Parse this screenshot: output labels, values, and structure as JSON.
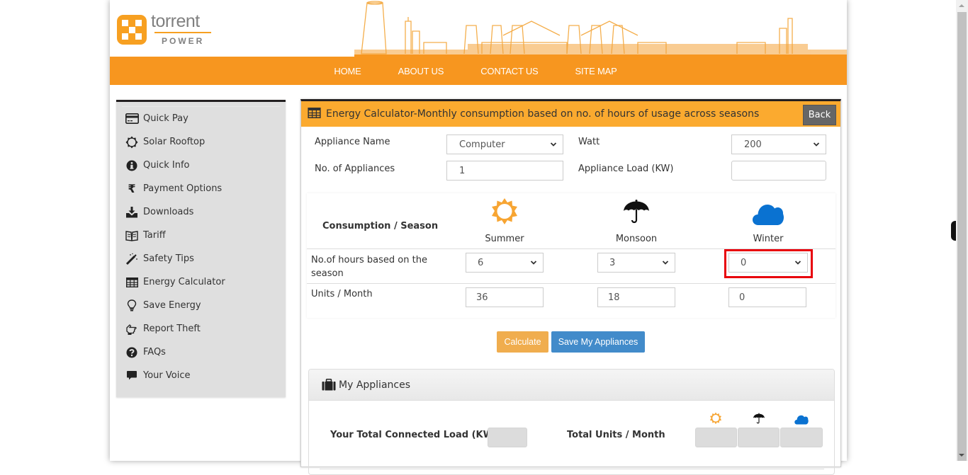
{
  "brand": {
    "name": "torrent",
    "sub": "POWER",
    "accent": "#f7961f"
  },
  "nav": {
    "items": [
      "HOME",
      "ABOUT US",
      "CONTACT US",
      "SITE MAP"
    ]
  },
  "sidebar": {
    "items": [
      {
        "label": "Quick Pay",
        "icon": "credit-card-icon"
      },
      {
        "label": "Solar Rooftop",
        "icon": "sun-outline-icon"
      },
      {
        "label": "Quick Info",
        "icon": "info-circle-icon"
      },
      {
        "label": "Payment Options",
        "icon": "rupee-icon"
      },
      {
        "label": "Downloads",
        "icon": "download-icon"
      },
      {
        "label": "Tariff",
        "icon": "book-icon"
      },
      {
        "label": "Safety Tips",
        "icon": "magic-wand-icon"
      },
      {
        "label": "Energy Calculator",
        "icon": "table-icon"
      },
      {
        "label": "Save Energy",
        "icon": "lightbulb-icon"
      },
      {
        "label": "Report Theft",
        "icon": "hand-pointer-icon"
      },
      {
        "label": "FAQs",
        "icon": "question-circle-icon"
      },
      {
        "label": "Your Voice",
        "icon": "comment-icon"
      }
    ]
  },
  "panel": {
    "title": "Energy Calculator-Monthly consumption based on no. of hours of usage across seasons",
    "back_label": "Back",
    "appliance_name_label": "Appliance Name",
    "appliance_name_value": "Computer",
    "watt_label": "Watt",
    "watt_value": "200",
    "num_appliances_label": "No. of Appliances",
    "num_appliances_value": "1",
    "appliance_load_label": "Appliance Load (KW)",
    "appliance_load_value": "",
    "consumption_header": "Consumption / Season",
    "seasons": [
      {
        "name": "Summer",
        "icon": "sun-icon",
        "hours": "6",
        "units": "36",
        "color": "#f7a533"
      },
      {
        "name": "Monsoon",
        "icon": "umbrella-icon",
        "hours": "3",
        "units": "18",
        "color": "#111111"
      },
      {
        "name": "Winter",
        "icon": "cloud-icon",
        "hours": "0",
        "units": "0",
        "color": "#0a72d1"
      }
    ],
    "hours_label": "No.of hours based on the season",
    "units_label": "Units / Month",
    "calculate_label": "Calculate",
    "save_label": "Save My Appliances"
  },
  "my_appliances": {
    "title": "My Appliances",
    "total_load_label": "Your Total Connected Load (KW)",
    "total_load_value": "",
    "total_units_label": "Total Units / Month",
    "summer_total": "",
    "monsoon_total": "",
    "winter_total": ""
  }
}
